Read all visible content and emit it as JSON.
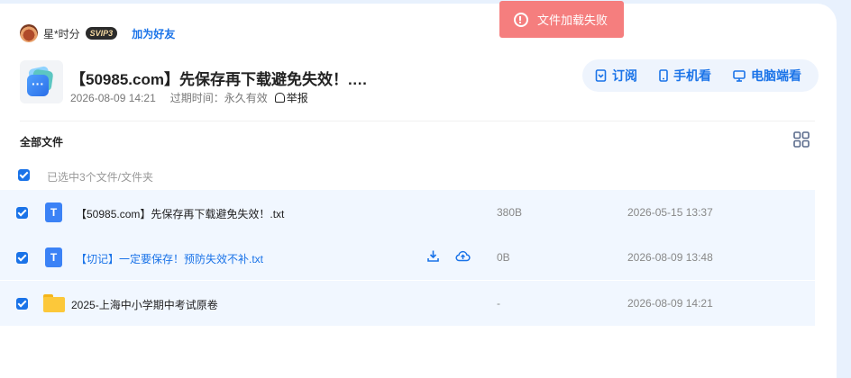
{
  "user": {
    "name": "星*时分",
    "vip_label": "SVIP3",
    "add_friend_label": "加为好友"
  },
  "share": {
    "title": "【50985.com】先保存再下载避免失效！.…",
    "date": "2026-08-09 14:21",
    "expiry": "过期时间：永久有效",
    "report_label": "举报"
  },
  "actions": {
    "subscribe": "订阅",
    "mobile": "手机看",
    "pc": "电脑端看"
  },
  "files": {
    "section_title": "全部文件",
    "selection_text": "已选中3个文件/文件夹",
    "rows": [
      {
        "name": "【50985.com】先保存再下载避免失效！.txt",
        "size": "380B",
        "date": "2026-05-15 13:37"
      },
      {
        "name": "【切记】一定要保存！预防失效不补.txt",
        "size": "0B",
        "date": "2026-08-09 13:48"
      },
      {
        "name": "2025-上海中小学期中考试原卷",
        "size": "-",
        "date": "2026-08-09 14:21"
      }
    ]
  },
  "toast": {
    "message": "文件加载失败"
  },
  "colors": {
    "accent": "#1a73e8",
    "toast_bg": "#f57e7e",
    "row_bg": "#f1f7ff"
  }
}
